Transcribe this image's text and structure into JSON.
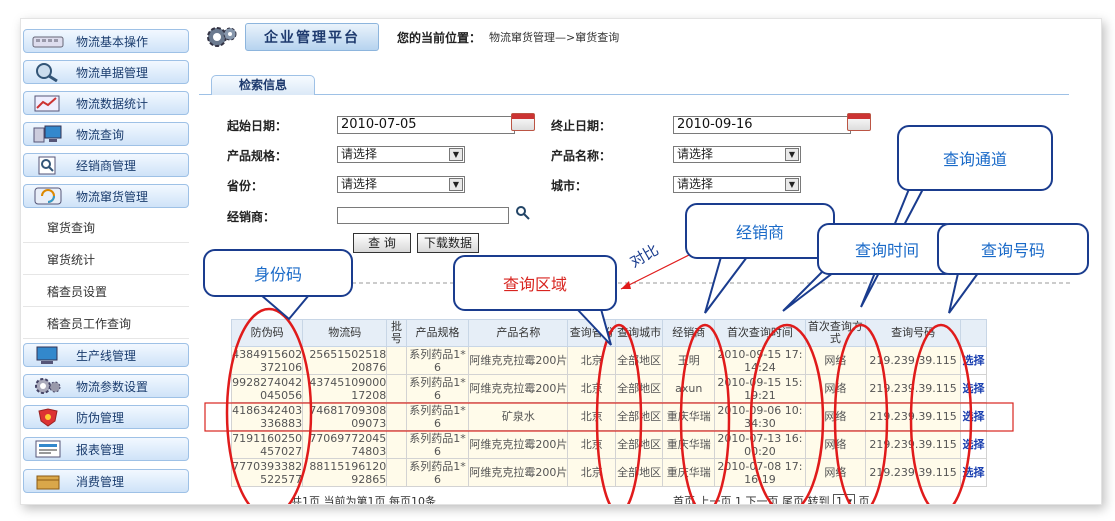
{
  "sidebar": {
    "items": [
      {
        "label": "物流基本操作",
        "icon": "keyboard-icon"
      },
      {
        "label": "物流单据管理",
        "icon": "magnifier-icon"
      },
      {
        "label": "物流数据统计",
        "icon": "chart-icon"
      },
      {
        "label": "物流查询",
        "icon": "computer-icon"
      },
      {
        "label": "经销商管理",
        "icon": "search-doc-icon"
      },
      {
        "label": "物流窜货管理",
        "icon": "refresh-icon"
      }
    ],
    "sub_items": [
      "窜货查询",
      "窜货统计",
      "稽查员设置",
      "稽查员工作查询"
    ],
    "lower_items": [
      {
        "label": "生产线管理",
        "icon": "computer-icon"
      },
      {
        "label": "物流参数设置",
        "icon": "gear-icon"
      },
      {
        "label": "防伪管理",
        "icon": "shield-icon"
      },
      {
        "label": "报表管理",
        "icon": "report-icon"
      },
      {
        "label": "消费管理",
        "icon": "box-icon"
      }
    ]
  },
  "header": {
    "title": "企业管理平台",
    "location_label": "您的当前位置：",
    "location_path": "物流窜货管理—>窜货查询"
  },
  "tab": {
    "label": "检索信息"
  },
  "form": {
    "start_date_label": "起始日期：",
    "start_date_value": "2010-07-05",
    "end_date_label": "终止日期：",
    "end_date_value": "2010-09-16",
    "spec_label": "产品规格：",
    "spec_value": "请选择",
    "name_label": "产品名称：",
    "name_value": "请选择",
    "province_label": "省份：",
    "province_value": "请选择",
    "city_label": "城市：",
    "city_value": "请选择",
    "dealer_label": "经销商：",
    "dealer_value": "",
    "query_button": "查 询",
    "download_button": "下载数据"
  },
  "table": {
    "headers": [
      "防伪码",
      "物流码",
      "批号",
      "产品规格",
      "产品名称",
      "查询省份",
      "查询城市",
      "经销商",
      "首次查询时间",
      "首次查询方式",
      "查询号码",
      ""
    ],
    "rows": [
      [
        "4384915602372106",
        "2565150251820876",
        "",
        "系列药品1*6",
        "阿维克克拉霉200片",
        "北京",
        "全部地区",
        "王明",
        "2010-09-15 17:14:24",
        "网络",
        "219.239.39.115",
        "选择"
      ],
      [
        "9928274042045056",
        "4374510900017208",
        "",
        "系列药品1*6",
        "阿维克克拉霉200片",
        "北京",
        "全部地区",
        "axun",
        "2010-09-15 15:19:21",
        "网络",
        "219.239.39.115",
        "选择"
      ],
      [
        "4186342403336883",
        "7468170930809073",
        "",
        "系列药品1*6",
        "矿泉水",
        "北京",
        "全部地区",
        "重庆华瑞",
        "2010-09-06 10:34:30",
        "网络",
        "219.239.39.115",
        "选择"
      ],
      [
        "7191160250457027",
        "7706977204574803",
        "",
        "系列药品1*6",
        "阿维克克拉霉200片",
        "北京",
        "全部地区",
        "重庆华瑞",
        "2010-07-13 16:00:20",
        "网络",
        "219.239.39.115",
        "选择"
      ],
      [
        "7770393382522577",
        "8811519612092865",
        "",
        "系列药品1*6",
        "阿维克克拉霉200片",
        "北京",
        "全部地区",
        "重庆华瑞",
        "2010-07-08 17:16:19",
        "网络",
        "219.239.39.115",
        "选择"
      ]
    ]
  },
  "pager": {
    "left": "共1页  当前为第1页  每页10条",
    "right": "首页 上一页 1 下一页 尾页  转到",
    "page_select": "1",
    "page_suffix": "页"
  },
  "annotations": {
    "id_code": "身份码",
    "query_area": "查询区域",
    "compare": "对比",
    "dealer": "经销商",
    "query_time": "查询时间",
    "query_channel": "查询通道",
    "query_number": "查询号码"
  },
  "colors": {
    "annotation_red": "#d8241f",
    "annotation_blue": "#1a6ac8",
    "link_blue": "#1a3fb0"
  }
}
